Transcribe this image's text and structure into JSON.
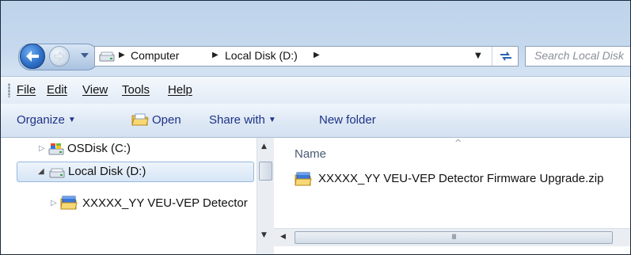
{
  "address": {
    "crumbs": [
      "Computer",
      "Local Disk (D:)"
    ],
    "search_placeholder": "Search Local Disk"
  },
  "menu": {
    "items": [
      "File",
      "Edit",
      "View",
      "Tools",
      "Help"
    ]
  },
  "commands": {
    "organize": "Organize",
    "open": "Open",
    "share_with": "Share with",
    "new_folder": "New folder"
  },
  "tree": {
    "items": [
      {
        "label": "OSDisk (C:)",
        "icon": "os-drive-icon",
        "selected": false
      },
      {
        "label": "Local Disk (D:)",
        "icon": "drive-icon",
        "selected": true
      },
      {
        "label": "XXXXX_YY VEU-VEP Detector",
        "icon": "zip-folder-icon",
        "selected": false
      }
    ]
  },
  "files": {
    "column_name": "Name",
    "items": [
      {
        "name": "XXXXX_YY VEU-VEP Detector Firmware Upgrade.zip",
        "icon": "zip-folder-icon"
      }
    ]
  },
  "scrollbar": {
    "thumb_grip": "III"
  },
  "colors": {
    "command_text": "#1e3287",
    "frame": "#c5d8ee",
    "selection": "#d6e5f6"
  }
}
